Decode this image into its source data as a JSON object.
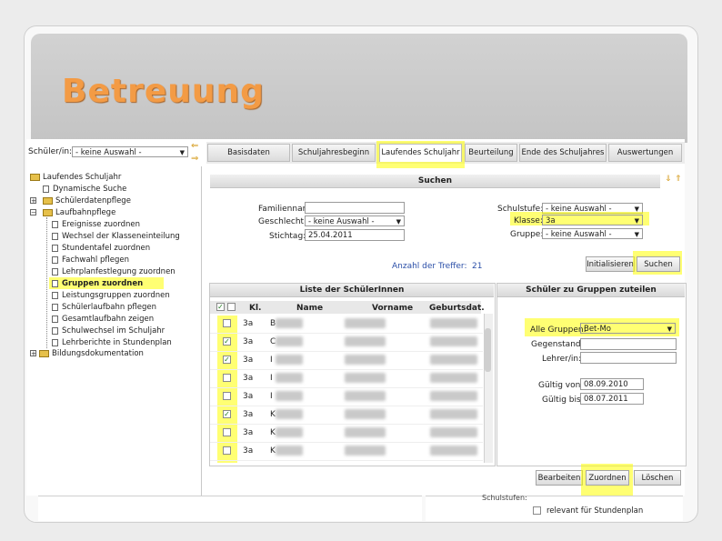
{
  "slide": {
    "title": "Betreuung"
  },
  "header": {
    "schueler_label": "Schüler/in:",
    "schueler_value": "- keine Auswahl -"
  },
  "tabs": [
    {
      "label": "Basisdaten"
    },
    {
      "label": "Schuljahresbeginn"
    },
    {
      "label": "Laufendes Schuljahr",
      "active": true
    },
    {
      "label": "Beurteilung"
    },
    {
      "label": "Ende des Schuljahres"
    },
    {
      "label": "Auswertungen"
    }
  ],
  "tree": {
    "root": "Laufendes Schuljahr",
    "items": [
      "Dynamische Suche",
      "Schülerdatenpflege",
      "Laufbahnpflege",
      "Ereignisse zuordnen",
      "Wechsel der Klasseneinteilung",
      "Stundentafel zuordnen",
      "Fachwahl pflegen",
      "Lehrplanfestlegung zuordnen",
      "Gruppen zuordnen",
      "Leistungsgruppen zuordnen",
      "Schülerlaufbahn pflegen",
      "Gesamtlaufbahn zeigen",
      "Schulwechsel im Schuljahr",
      "Lehrberichte in Stundenplan",
      "Bildungsdokumentation"
    ]
  },
  "search": {
    "title": "Suchen",
    "familienname_label": "Familienname:",
    "familienname_value": "",
    "geschlecht_label": "Geschlecht:",
    "geschlecht_value": "- keine Auswahl -",
    "stichtag_label": "Stichtag:",
    "stichtag_value": "25.04.2011",
    "schulstufe_label": "Schulstufe:",
    "schulstufe_value": "- keine Auswahl -",
    "klasse_label": "Klasse:",
    "klasse_value": "3a",
    "gruppe_label": "Gruppe:",
    "gruppe_value": "- keine Auswahl -",
    "treffer_label": "Anzahl der Treffer:",
    "treffer_value": "21",
    "init_button": "Initialisieren",
    "search_button": "Suchen"
  },
  "list": {
    "title": "Liste der SchülerInnen",
    "columns": [
      "Kl.",
      "Name",
      "Vorname",
      "Geburtsdat."
    ],
    "rows": [
      {
        "checked": false,
        "kl": "3a",
        "name_initial": "B"
      },
      {
        "checked": true,
        "kl": "3a",
        "name_initial": "C"
      },
      {
        "checked": true,
        "kl": "3a",
        "name_initial": "I"
      },
      {
        "checked": false,
        "kl": "3a",
        "name_initial": "I"
      },
      {
        "checked": false,
        "kl": "3a",
        "name_initial": "I"
      },
      {
        "checked": true,
        "kl": "3a",
        "name_initial": "K"
      },
      {
        "checked": false,
        "kl": "3a",
        "name_initial": "K"
      },
      {
        "checked": false,
        "kl": "3a",
        "name_initial": "K"
      }
    ]
  },
  "assign": {
    "title": "Schüler zu Gruppen zuteilen",
    "gruppen_label": "Alle Gruppen:",
    "gruppen_value": "Bet-Mo",
    "gegenstand_label": "Gegenstand:",
    "lehrer_label": "Lehrer/in:",
    "gueltig_von_label": "Gültig von:",
    "gueltig_von_value": "08.09.2010",
    "gueltig_bis_label": "Gültig bis:",
    "gueltig_bis_value": "08.07.2011",
    "edit_button": "Bearbeiten",
    "assign_button": "Zuordnen",
    "delete_button": "Löschen"
  },
  "footer": {
    "partial_label": "Schulstufen:",
    "relevant_label": "relevant für Stundenplan"
  },
  "colors": {
    "title": "#f39b45",
    "highlight": "#ffff00",
    "link_blue": "#2b4fa8"
  }
}
